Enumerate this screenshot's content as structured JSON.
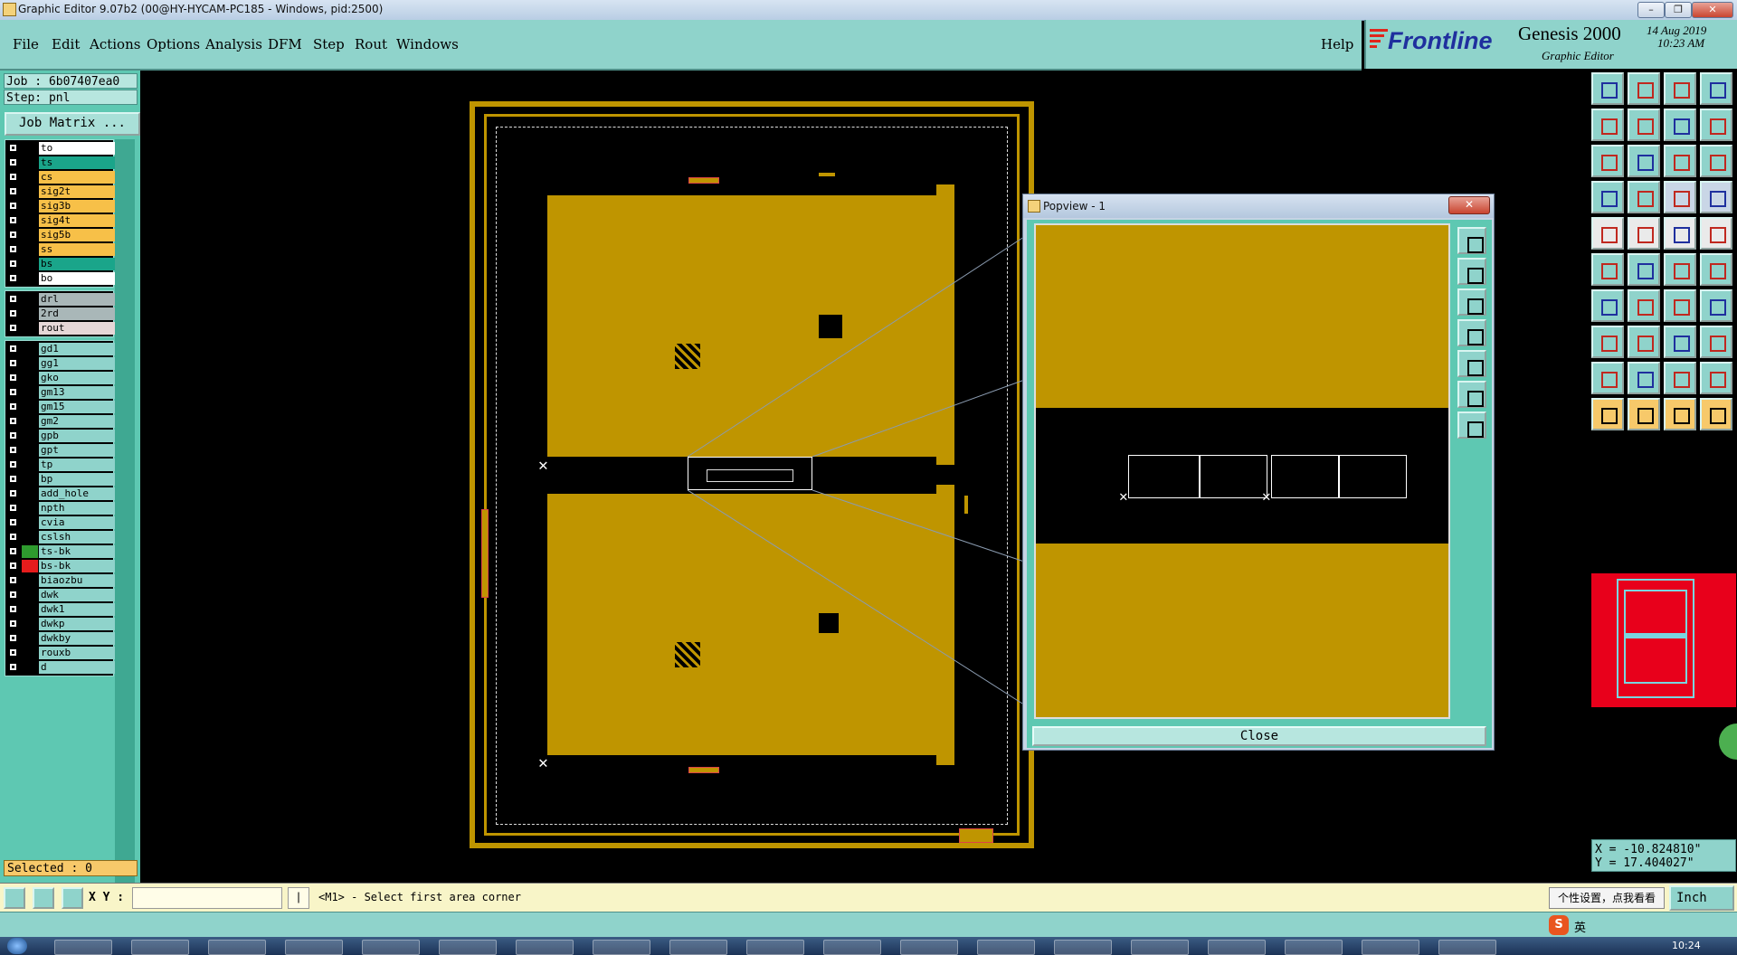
{
  "window": {
    "title": "Graphic Editor 9.07b2 (00@HY-HYCAM-PC185 - Windows, pid:2500)",
    "minimize": "–",
    "maximize": "❐",
    "close": "✕"
  },
  "menu": {
    "items": [
      "File",
      "Edit",
      "Actions",
      "Options",
      "Analysis",
      "DFM",
      "Step",
      "Rout",
      "Windows"
    ],
    "help": "Help"
  },
  "brand": {
    "logo": "Frontline",
    "product": "Genesis 2000",
    "subtitle": "Graphic Editor",
    "date": "14 Aug 2019",
    "time": "10:23 AM"
  },
  "left": {
    "job": "Job : 6b07407ea0",
    "step": "Step: pnl",
    "job_matrix": "Job Matrix ...",
    "groups": [
      [
        {
          "name": "to",
          "color": "#ffffff"
        },
        {
          "name": "ts",
          "color": "#1aa58a"
        },
        {
          "name": "cs",
          "color": "#f7c048"
        },
        {
          "name": "sig2t",
          "color": "#f7c048"
        },
        {
          "name": "sig3b",
          "color": "#f7c048"
        },
        {
          "name": "sig4t",
          "color": "#f7c048"
        },
        {
          "name": "sig5b",
          "color": "#f7c048"
        },
        {
          "name": "ss",
          "color": "#f7c048"
        },
        {
          "name": "bs",
          "color": "#1aa58a"
        },
        {
          "name": "bo",
          "color": "#ffffff"
        }
      ],
      [
        {
          "name": "drl",
          "color": "#a9b7b8"
        },
        {
          "name": "2rd",
          "color": "#a9b7b8"
        },
        {
          "name": "rout",
          "color": "#e6d7d7"
        }
      ],
      [
        {
          "name": "gd1",
          "color": "#8fd3cb"
        },
        {
          "name": "gg1",
          "color": "#8fd3cb"
        },
        {
          "name": "gko",
          "color": "#8fd3cb"
        },
        {
          "name": "gm13",
          "color": "#8fd3cb"
        },
        {
          "name": "gm15",
          "color": "#8fd3cb"
        },
        {
          "name": "gm2",
          "color": "#8fd3cb"
        },
        {
          "name": "gpb",
          "color": "#8fd3cb"
        },
        {
          "name": "gpt",
          "color": "#8fd3cb"
        },
        {
          "name": "tp",
          "color": "#8fd3cb"
        },
        {
          "name": "bp",
          "color": "#8fd3cb"
        },
        {
          "name": "add_hole",
          "color": "#8fd3cb"
        },
        {
          "name": "npth",
          "color": "#8fd3cb"
        },
        {
          "name": "cvia",
          "color": "#8fd3cb"
        },
        {
          "name": "cslsh",
          "color": "#8fd3cb"
        },
        {
          "name": "ts-bk",
          "color": "#8fd3cb",
          "swatch": "#2e9b2e"
        },
        {
          "name": "bs-bk",
          "color": "#8fd3cb",
          "swatch": "#e61c1c",
          "active": true
        },
        {
          "name": "biaozbu",
          "color": "#8fd3cb"
        },
        {
          "name": "dwk",
          "color": "#8fd3cb"
        },
        {
          "name": "dwk1",
          "color": "#8fd3cb"
        },
        {
          "name": "dwkp",
          "color": "#8fd3cb"
        },
        {
          "name": "dwkby",
          "color": "#8fd3cb"
        },
        {
          "name": "rouxb",
          "color": "#8fd3cb"
        },
        {
          "name": "d",
          "color": "#8fd3cb"
        }
      ]
    ],
    "selected": "Selected : 0"
  },
  "popview": {
    "title": "Popview - 1",
    "close_button": "Close"
  },
  "coords": {
    "x": "X = -10.824810\"",
    "y": "Y = 17.404027\""
  },
  "command": {
    "xy_label": "X Y :",
    "xy_value": "",
    "prompt": "<M1> - Select first area corner",
    "tooltip": "个性设置，点我看看",
    "units": "Inch"
  },
  "taskbar": {
    "clock": "10:24",
    "ime": "英"
  },
  "colors": {
    "copper": "#bf9500",
    "panel_teal": "#8fd3cb",
    "side_teal": "#5ec8b2",
    "overview_red": "#e8001b"
  }
}
